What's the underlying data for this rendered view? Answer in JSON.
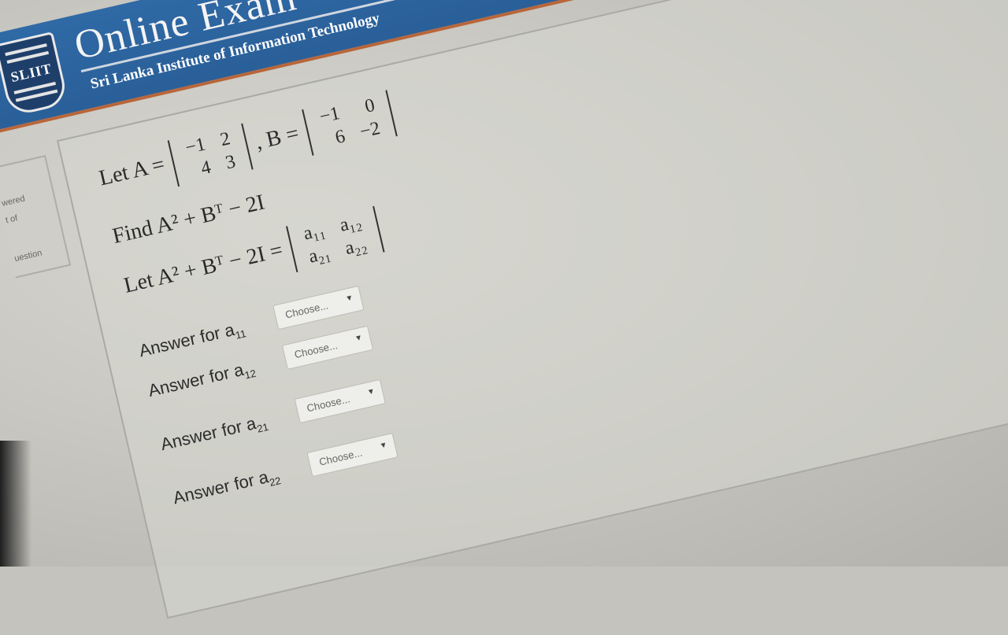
{
  "header": {
    "logo_text": "SLIIT",
    "title": "Online Exam",
    "subtitle": "Sri Lanka Institute of Information Technology"
  },
  "sidebar": {
    "lines": [
      "wered",
      "t of",
      "uestion"
    ]
  },
  "question": {
    "let_a_prefix": "Let A =",
    "matrix_a": [
      [
        "−1",
        "2"
      ],
      [
        "4",
        "3"
      ]
    ],
    "b_prefix": ", B =",
    "matrix_b": [
      [
        "−1",
        "0"
      ],
      [
        "6",
        "−2"
      ]
    ],
    "find_text": "Find A² + Bᵀ − 2I",
    "let_expr_prefix": "Let A² + Bᵀ − 2I =",
    "matrix_c": [
      [
        "a₁₁",
        "a₁₂"
      ],
      [
        "a₂₁",
        "a₂₂"
      ]
    ]
  },
  "answers": [
    {
      "label": "Answer for a",
      "sub": "11",
      "select": "Choose..."
    },
    {
      "label": "Answer for a",
      "sub": "12",
      "select": "Choose..."
    },
    {
      "label": "Answer for a",
      "sub": "21",
      "select": "Choose..."
    },
    {
      "label": "Answer for a",
      "sub": "22",
      "select": "Choose..."
    }
  ],
  "icons": {
    "select_caret": "caret-down-icon"
  }
}
